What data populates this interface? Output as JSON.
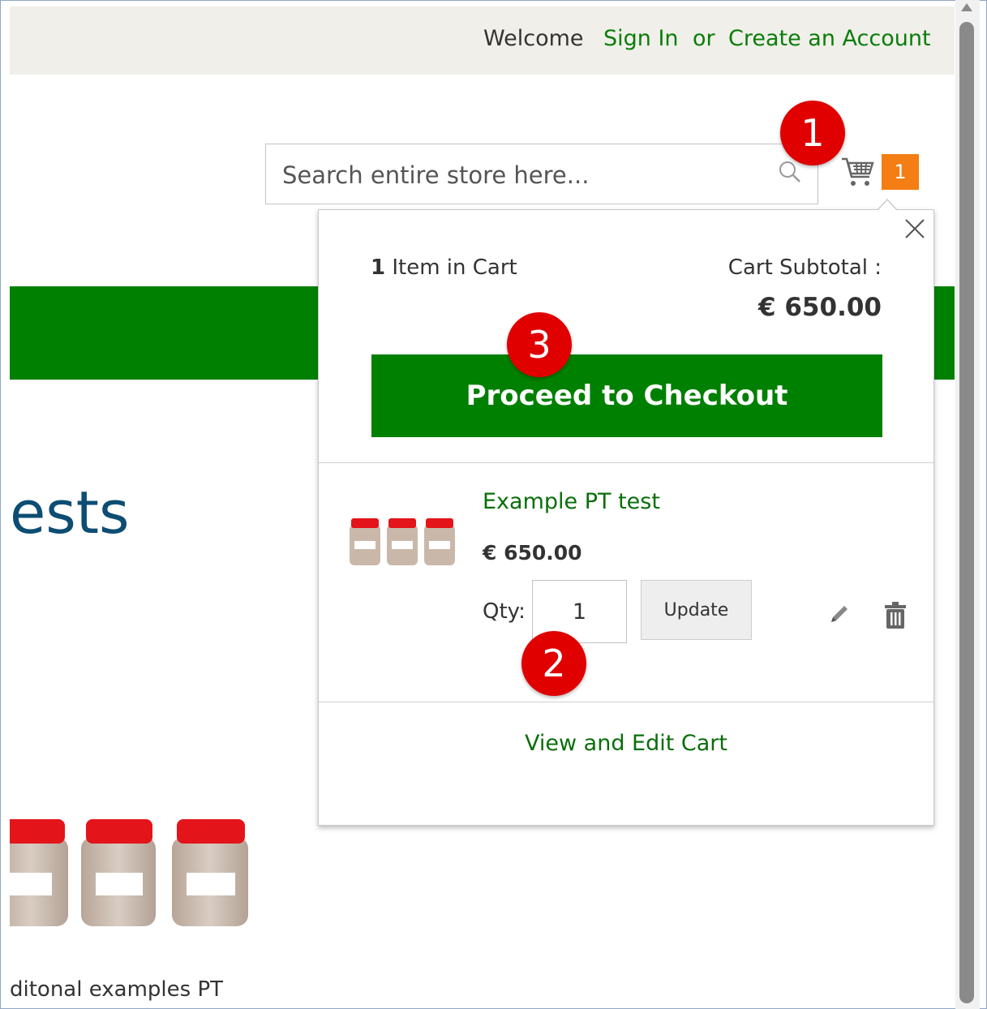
{
  "header": {
    "welcome": "Welcome",
    "sign_in": "Sign In",
    "or": "or",
    "create_account": "Create an Account"
  },
  "search": {
    "placeholder": "Search entire store here..."
  },
  "cart": {
    "count": "1",
    "accent_color": "#f47d14"
  },
  "background": {
    "heading_fragment": "ests",
    "caption_fragment": "ditonal examples PT",
    "band_color": "#008000"
  },
  "minicart": {
    "items_count_number": "1",
    "items_count_text": " Item in Cart",
    "subtotal_label": "Cart Subtotal :",
    "subtotal_value": "€ 650.00",
    "checkout_label": "Proceed to Checkout",
    "product": {
      "name": "Example PT test",
      "price": "€ 650.00",
      "qty_label": "Qty:",
      "qty_value": "1",
      "update_label": "Update"
    },
    "view_edit_label": "View and Edit Cart"
  },
  "annotations": {
    "badge_1": "1",
    "badge_2": "2",
    "badge_3": "3",
    "badge_color": "#e00000"
  },
  "icons": [
    "search-icon",
    "cart-icon",
    "close-icon",
    "edit-icon",
    "trash-icon"
  ]
}
